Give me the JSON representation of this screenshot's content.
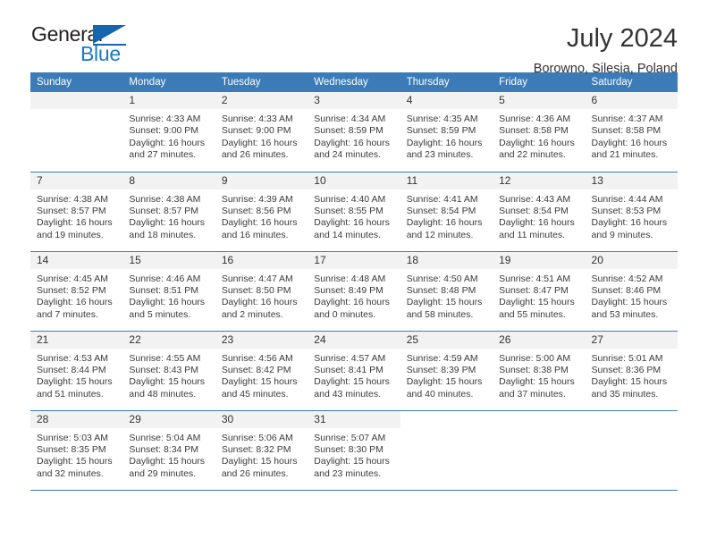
{
  "brand": {
    "name_part1": "General",
    "name_part2": "Blue",
    "triangle_color": "#1566ae",
    "blue_color": "#1a7ac4",
    "dark_color": "#231f20"
  },
  "header": {
    "title": "July 2024",
    "subtitle": "Borowno, Silesia, Poland",
    "header_bg": "#3b7cb8",
    "daynum_bg": "#f2f2f2"
  },
  "weekdays": [
    "Sunday",
    "Monday",
    "Tuesday",
    "Wednesday",
    "Thursday",
    "Friday",
    "Saturday"
  ],
  "labels": {
    "sunrise": "Sunrise:",
    "sunset": "Sunset:",
    "daylight": "Daylight:"
  },
  "weeks": [
    [
      {
        "day": "",
        "sunrise": "",
        "sunset": "",
        "daylight_line1": "",
        "daylight_line2": ""
      },
      {
        "day": "1",
        "sunrise": "Sunrise: 4:33 AM",
        "sunset": "Sunset: 9:00 PM",
        "daylight_line1": "Daylight: 16 hours",
        "daylight_line2": "and 27 minutes."
      },
      {
        "day": "2",
        "sunrise": "Sunrise: 4:33 AM",
        "sunset": "Sunset: 9:00 PM",
        "daylight_line1": "Daylight: 16 hours",
        "daylight_line2": "and 26 minutes."
      },
      {
        "day": "3",
        "sunrise": "Sunrise: 4:34 AM",
        "sunset": "Sunset: 8:59 PM",
        "daylight_line1": "Daylight: 16 hours",
        "daylight_line2": "and 24 minutes."
      },
      {
        "day": "4",
        "sunrise": "Sunrise: 4:35 AM",
        "sunset": "Sunset: 8:59 PM",
        "daylight_line1": "Daylight: 16 hours",
        "daylight_line2": "and 23 minutes."
      },
      {
        "day": "5",
        "sunrise": "Sunrise: 4:36 AM",
        "sunset": "Sunset: 8:58 PM",
        "daylight_line1": "Daylight: 16 hours",
        "daylight_line2": "and 22 minutes."
      },
      {
        "day": "6",
        "sunrise": "Sunrise: 4:37 AM",
        "sunset": "Sunset: 8:58 PM",
        "daylight_line1": "Daylight: 16 hours",
        "daylight_line2": "and 21 minutes."
      }
    ],
    [
      {
        "day": "7",
        "sunrise": "Sunrise: 4:38 AM",
        "sunset": "Sunset: 8:57 PM",
        "daylight_line1": "Daylight: 16 hours",
        "daylight_line2": "and 19 minutes."
      },
      {
        "day": "8",
        "sunrise": "Sunrise: 4:38 AM",
        "sunset": "Sunset: 8:57 PM",
        "daylight_line1": "Daylight: 16 hours",
        "daylight_line2": "and 18 minutes."
      },
      {
        "day": "9",
        "sunrise": "Sunrise: 4:39 AM",
        "sunset": "Sunset: 8:56 PM",
        "daylight_line1": "Daylight: 16 hours",
        "daylight_line2": "and 16 minutes."
      },
      {
        "day": "10",
        "sunrise": "Sunrise: 4:40 AM",
        "sunset": "Sunset: 8:55 PM",
        "daylight_line1": "Daylight: 16 hours",
        "daylight_line2": "and 14 minutes."
      },
      {
        "day": "11",
        "sunrise": "Sunrise: 4:41 AM",
        "sunset": "Sunset: 8:54 PM",
        "daylight_line1": "Daylight: 16 hours",
        "daylight_line2": "and 12 minutes."
      },
      {
        "day": "12",
        "sunrise": "Sunrise: 4:43 AM",
        "sunset": "Sunset: 8:54 PM",
        "daylight_line1": "Daylight: 16 hours",
        "daylight_line2": "and 11 minutes."
      },
      {
        "day": "13",
        "sunrise": "Sunrise: 4:44 AM",
        "sunset": "Sunset: 8:53 PM",
        "daylight_line1": "Daylight: 16 hours",
        "daylight_line2": "and 9 minutes."
      }
    ],
    [
      {
        "day": "14",
        "sunrise": "Sunrise: 4:45 AM",
        "sunset": "Sunset: 8:52 PM",
        "daylight_line1": "Daylight: 16 hours",
        "daylight_line2": "and 7 minutes."
      },
      {
        "day": "15",
        "sunrise": "Sunrise: 4:46 AM",
        "sunset": "Sunset: 8:51 PM",
        "daylight_line1": "Daylight: 16 hours",
        "daylight_line2": "and 5 minutes."
      },
      {
        "day": "16",
        "sunrise": "Sunrise: 4:47 AM",
        "sunset": "Sunset: 8:50 PM",
        "daylight_line1": "Daylight: 16 hours",
        "daylight_line2": "and 2 minutes."
      },
      {
        "day": "17",
        "sunrise": "Sunrise: 4:48 AM",
        "sunset": "Sunset: 8:49 PM",
        "daylight_line1": "Daylight: 16 hours",
        "daylight_line2": "and 0 minutes."
      },
      {
        "day": "18",
        "sunrise": "Sunrise: 4:50 AM",
        "sunset": "Sunset: 8:48 PM",
        "daylight_line1": "Daylight: 15 hours",
        "daylight_line2": "and 58 minutes."
      },
      {
        "day": "19",
        "sunrise": "Sunrise: 4:51 AM",
        "sunset": "Sunset: 8:47 PM",
        "daylight_line1": "Daylight: 15 hours",
        "daylight_line2": "and 55 minutes."
      },
      {
        "day": "20",
        "sunrise": "Sunrise: 4:52 AM",
        "sunset": "Sunset: 8:46 PM",
        "daylight_line1": "Daylight: 15 hours",
        "daylight_line2": "and 53 minutes."
      }
    ],
    [
      {
        "day": "21",
        "sunrise": "Sunrise: 4:53 AM",
        "sunset": "Sunset: 8:44 PM",
        "daylight_line1": "Daylight: 15 hours",
        "daylight_line2": "and 51 minutes."
      },
      {
        "day": "22",
        "sunrise": "Sunrise: 4:55 AM",
        "sunset": "Sunset: 8:43 PM",
        "daylight_line1": "Daylight: 15 hours",
        "daylight_line2": "and 48 minutes."
      },
      {
        "day": "23",
        "sunrise": "Sunrise: 4:56 AM",
        "sunset": "Sunset: 8:42 PM",
        "daylight_line1": "Daylight: 15 hours",
        "daylight_line2": "and 45 minutes."
      },
      {
        "day": "24",
        "sunrise": "Sunrise: 4:57 AM",
        "sunset": "Sunset: 8:41 PM",
        "daylight_line1": "Daylight: 15 hours",
        "daylight_line2": "and 43 minutes."
      },
      {
        "day": "25",
        "sunrise": "Sunrise: 4:59 AM",
        "sunset": "Sunset: 8:39 PM",
        "daylight_line1": "Daylight: 15 hours",
        "daylight_line2": "and 40 minutes."
      },
      {
        "day": "26",
        "sunrise": "Sunrise: 5:00 AM",
        "sunset": "Sunset: 8:38 PM",
        "daylight_line1": "Daylight: 15 hours",
        "daylight_line2": "and 37 minutes."
      },
      {
        "day": "27",
        "sunrise": "Sunrise: 5:01 AM",
        "sunset": "Sunset: 8:36 PM",
        "daylight_line1": "Daylight: 15 hours",
        "daylight_line2": "and 35 minutes."
      }
    ],
    [
      {
        "day": "28",
        "sunrise": "Sunrise: 5:03 AM",
        "sunset": "Sunset: 8:35 PM",
        "daylight_line1": "Daylight: 15 hours",
        "daylight_line2": "and 32 minutes."
      },
      {
        "day": "29",
        "sunrise": "Sunrise: 5:04 AM",
        "sunset": "Sunset: 8:34 PM",
        "daylight_line1": "Daylight: 15 hours",
        "daylight_line2": "and 29 minutes."
      },
      {
        "day": "30",
        "sunrise": "Sunrise: 5:06 AM",
        "sunset": "Sunset: 8:32 PM",
        "daylight_line1": "Daylight: 15 hours",
        "daylight_line2": "and 26 minutes."
      },
      {
        "day": "31",
        "sunrise": "Sunrise: 5:07 AM",
        "sunset": "Sunset: 8:30 PM",
        "daylight_line1": "Daylight: 15 hours",
        "daylight_line2": "and 23 minutes."
      },
      {
        "day": "",
        "sunrise": "",
        "sunset": "",
        "daylight_line1": "",
        "daylight_line2": ""
      },
      {
        "day": "",
        "sunrise": "",
        "sunset": "",
        "daylight_line1": "",
        "daylight_line2": ""
      },
      {
        "day": "",
        "sunrise": "",
        "sunset": "",
        "daylight_line1": "",
        "daylight_line2": ""
      }
    ]
  ]
}
